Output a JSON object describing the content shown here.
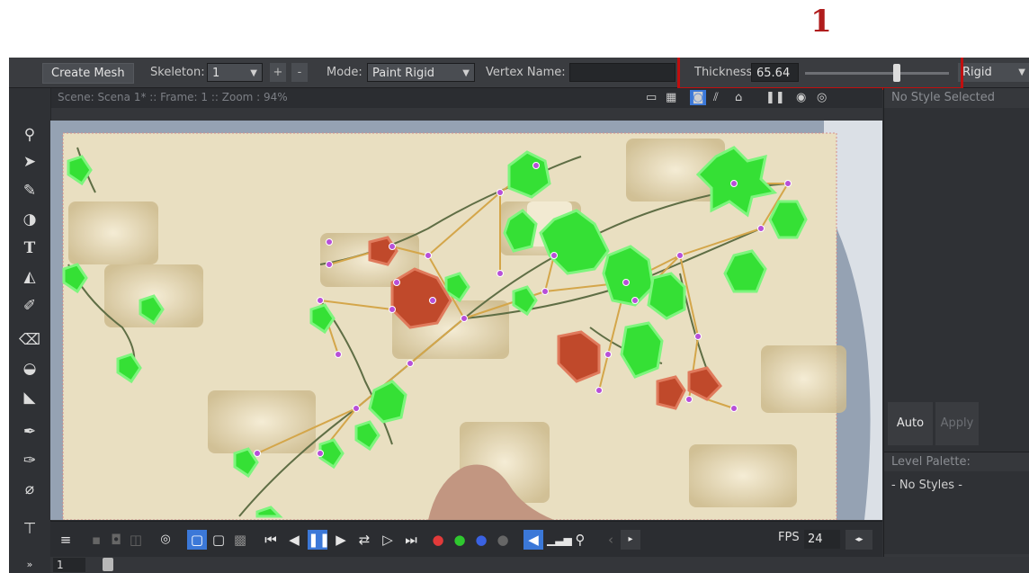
{
  "callout": {
    "number": "1"
  },
  "toolbar": {
    "create_mesh": "Create Mesh",
    "skeleton_label": "Skeleton:",
    "skeleton_value": "1",
    "plus": "+",
    "minus": "-",
    "mode_label": "Mode:",
    "mode_value": "Paint Rigid",
    "vertex_name_label": "Vertex Name:",
    "vertex_name_value": "",
    "thickness_label": "Thickness",
    "thickness_value": "65.64",
    "thickness_slider_fraction": 0.64,
    "rigid_value": "Rigid"
  },
  "viewer": {
    "status": "Scene: Scena 1*  ::  Frame: 1  ::  Zoom : 94%"
  },
  "style_panel": {
    "no_style": "No Style Selected",
    "auto": "Auto",
    "apply": "Apply"
  },
  "level_palette": {
    "title": "Level Palette:",
    "no_styles": "- No Styles -"
  },
  "playback": {
    "fps_label": "FPS",
    "fps_value": "24",
    "frame_value": "1"
  },
  "colors": {
    "accent_blue": "#3b78d8",
    "highlight_red": "#c00f0f",
    "leaf_green": "#35e035",
    "leaf_red": "#c0492b",
    "canvas_beige": "#e9dfc1"
  }
}
